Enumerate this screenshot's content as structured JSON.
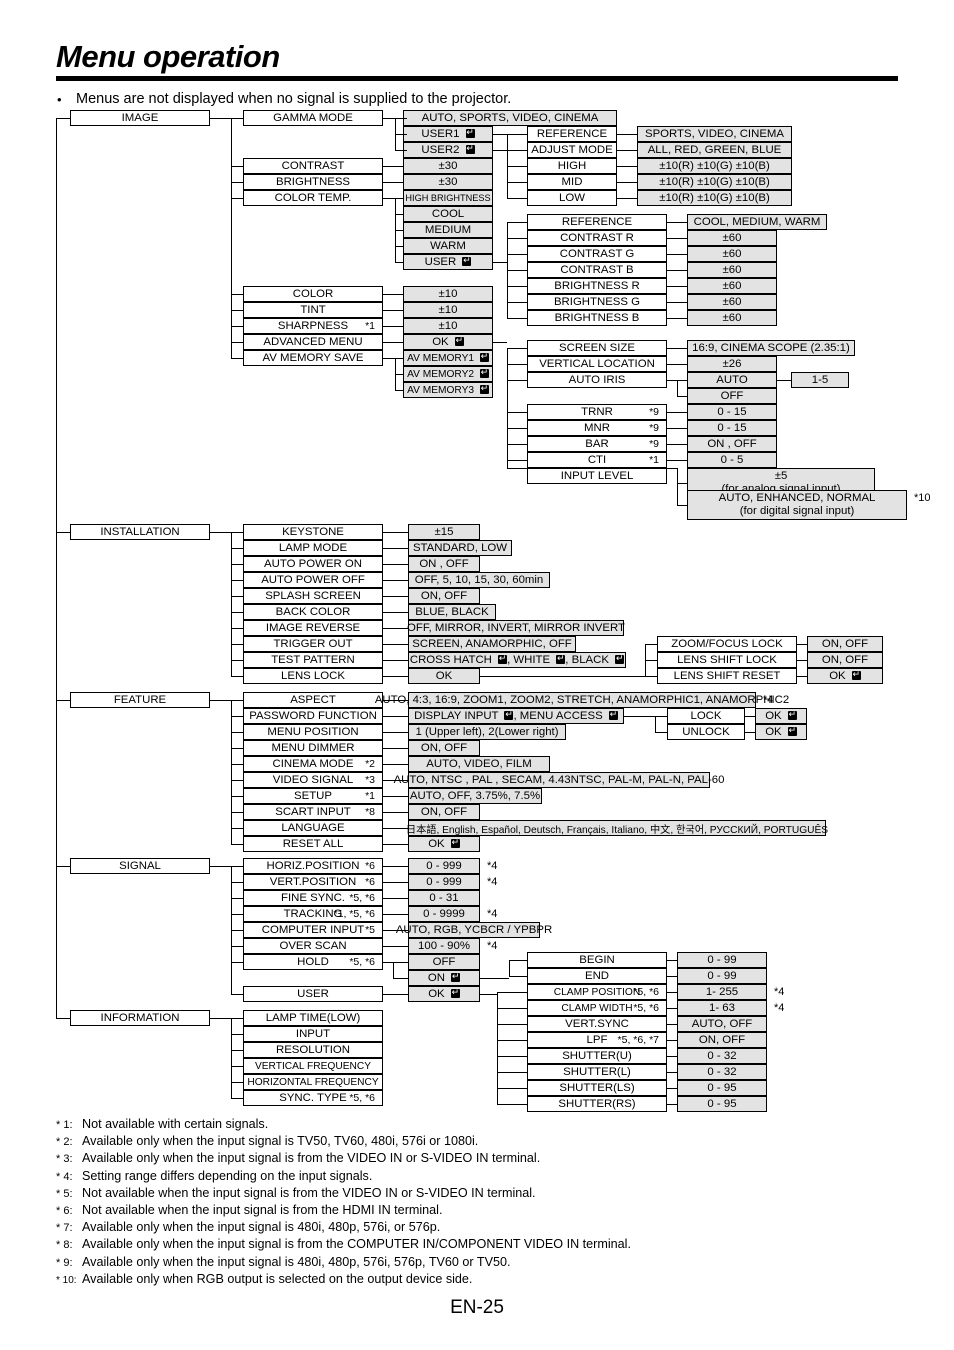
{
  "header": {
    "title": "Menu operation",
    "bullet": "Menus are not displayed when no signal is supplied to the projector.",
    "bullet_marker": "•"
  },
  "page_number": "EN-25",
  "menus": {
    "image": "IMAGE",
    "installation": "INSTALLATION",
    "feature": "FEATURE",
    "signal": "SIGNAL",
    "information": "INFORMATION"
  },
  "image_section": {
    "items": [
      {
        "label": "GAMMA MODE",
        "values": [
          "AUTO, SPORTS, VIDEO, CINEMA",
          "USER1",
          "USER2"
        ]
      },
      {
        "label": "CONTRAST",
        "values": [
          "±30"
        ]
      },
      {
        "label": "BRIGHTNESS",
        "values": [
          "±30"
        ]
      },
      {
        "label": "COLOR TEMP.",
        "values": [
          "HIGH BRIGHTNESS",
          "COOL",
          "MEDIUM",
          "WARM",
          "USER"
        ]
      },
      {
        "label": "COLOR",
        "values": [
          "±10"
        ]
      },
      {
        "label": "TINT",
        "values": [
          "±10"
        ]
      },
      {
        "label": "SHARPNESS",
        "footnote": "*1",
        "values": [
          "±10"
        ]
      },
      {
        "label": "ADVANCED MENU",
        "values": [
          "OK"
        ]
      },
      {
        "label": "AV MEMORY SAVE",
        "values": [
          "AV MEMORY1",
          "AV MEMORY2",
          "AV MEMORY3"
        ]
      }
    ],
    "gamma_user": {
      "rows": [
        {
          "label": "REFERENCE",
          "value": "SPORTS, VIDEO, CINEMA"
        },
        {
          "label": "ADJUST MODE",
          "value": "ALL, RED, GREEN, BLUE"
        },
        {
          "label": "HIGH",
          "value": "±10(R) ±10(G) ±10(B)"
        },
        {
          "label": "MID",
          "value": "±10(R) ±10(G) ±10(B)"
        },
        {
          "label": "LOW",
          "value": "±10(R) ±10(G) ±10(B)"
        }
      ]
    },
    "color_temp_user": {
      "rows": [
        {
          "label": "REFERENCE",
          "value": "COOL, MEDIUM, WARM"
        },
        {
          "label": "CONTRAST R",
          "value": "±60"
        },
        {
          "label": "CONTRAST G",
          "value": "±60"
        },
        {
          "label": "CONTRAST B",
          "value": "±60"
        },
        {
          "label": "BRIGHTNESS R",
          "value": "±60"
        },
        {
          "label": "BRIGHTNESS G",
          "value": "±60"
        },
        {
          "label": "BRIGHTNESS B",
          "value": "±60"
        }
      ]
    },
    "advanced_menu": {
      "rows": [
        {
          "label": "SCREEN SIZE",
          "value": "16:9, CINEMA SCOPE (2.35:1)"
        },
        {
          "label": "VERTICAL LOCATION",
          "value": "±26"
        },
        {
          "label": "AUTO IRIS",
          "value": "AUTO",
          "value2": "OFF",
          "sub": "1-5"
        },
        {
          "label": "TRNR",
          "footnote": "*9",
          "value": "0 - 15"
        },
        {
          "label": "MNR",
          "footnote": "*9",
          "value": "0 - 15"
        },
        {
          "label": "BAR",
          "footnote": "*9",
          "value": "ON , OFF"
        },
        {
          "label": "CTI",
          "footnote": "*1",
          "value": "0 - 5"
        },
        {
          "label": "INPUT LEVEL",
          "value": "",
          "value2": ""
        }
      ],
      "input_level_analog_l1": "±5",
      "input_level_analog_l2": "(for analog signal input)",
      "input_level_digital_l1": "AUTO, ENHANCED, NORMAL",
      "input_level_digital_l2": "(for digital signal input)",
      "input_level_digital_note": "*10"
    }
  },
  "installation_section": {
    "items": [
      {
        "label": "KEYSTONE",
        "value": "±15"
      },
      {
        "label": "LAMP MODE",
        "value": "STANDARD, LOW"
      },
      {
        "label": "AUTO POWER ON",
        "value": "ON , OFF"
      },
      {
        "label": "AUTO POWER OFF",
        "value": "OFF, 5, 10, 15, 30, 60min"
      },
      {
        "label": "SPLASH SCREEN",
        "value": "ON, OFF"
      },
      {
        "label": "BACK COLOR",
        "value": "BLUE, BLACK"
      },
      {
        "label": "IMAGE REVERSE",
        "value": "OFF, MIRROR, INVERT, MIRROR INVERT"
      },
      {
        "label": "TRIGGER OUT",
        "value": "SCREEN, ANAMORPHIC, OFF"
      },
      {
        "label": "TEST PATTERN",
        "value": "CROSS HATCH ↵, WHITE ↵, BLACK ↵"
      },
      {
        "label": "LENS LOCK",
        "value": "OK"
      }
    ],
    "lens_lock": {
      "rows": [
        {
          "label": "ZOOM/FOCUS LOCK",
          "value": "ON, OFF"
        },
        {
          "label": "LENS SHIFT LOCK",
          "value": "ON, OFF"
        },
        {
          "label": "LENS SHIFT RESET",
          "value": "OK"
        }
      ]
    }
  },
  "feature_section": {
    "items": [
      {
        "label": "ASPECT",
        "value": "AUTO, 4:3, 16:9, ZOOM1, ZOOM2, STRETCH, ANAMORPHIC1, ANAMORPHIC2",
        "note": "*4"
      },
      {
        "label": "PASSWORD FUNCTION",
        "value": "DISPLAY INPUT ↵, MENU ACCESS ↵"
      },
      {
        "label": "MENU POSITION",
        "value": "1 (Upper left), 2(Lower right)"
      },
      {
        "label": "MENU DIMMER",
        "value": "ON, OFF"
      },
      {
        "label": "CINEMA MODE",
        "footnote": "*2",
        "value": "AUTO, VIDEO, FILM"
      },
      {
        "label": "VIDEO SIGNAL",
        "footnote": "*3",
        "value": "AUTO, NTSC , PAL , SECAM, 4.43NTSC, PAL-M, PAL-N, PAL-60"
      },
      {
        "label": "SETUP",
        "footnote": "*1",
        "value": "AUTO, OFF, 3.75%, 7.5%"
      },
      {
        "label": "SCART INPUT",
        "footnote": "*8",
        "value": "ON, OFF"
      },
      {
        "label": "LANGUAGE",
        "value": "日本語, English, Español, Deutsch, Français, Italiano, 中文, 한국어, РУССКИЙ, PORTUGUÊS"
      },
      {
        "label": "RESET ALL",
        "value": "OK"
      }
    ],
    "password": {
      "rows": [
        {
          "label": "LOCK",
          "value": "OK"
        },
        {
          "label": "UNLOCK",
          "value": "OK"
        }
      ]
    }
  },
  "signal_section": {
    "items": [
      {
        "label": "HORIZ.POSITION",
        "footnote": "*6",
        "value": "0 - 999",
        "note": "*4"
      },
      {
        "label": "VERT.POSITION",
        "footnote": "*6",
        "value": "0 - 999",
        "note": "*4"
      },
      {
        "label": "FINE SYNC.",
        "footnote": "*5, *6",
        "value": "0 - 31"
      },
      {
        "label": "TRACKING",
        "footnote": "*1, *5, *6",
        "value": "0 - 9999",
        "note": "*4"
      },
      {
        "label": "COMPUTER INPUT",
        "footnote": "*5",
        "value": "AUTO, RGB, YCBCR / YPBPR"
      },
      {
        "label": "OVER SCAN",
        "value": "100 - 90%",
        "note": "*4"
      },
      {
        "label": "HOLD",
        "footnote": "*5, *6",
        "value": "OFF",
        "value2": "ON"
      },
      {
        "label": "USER",
        "value": "OK"
      }
    ],
    "hold_sub": {
      "rows": [
        {
          "label": "BEGIN",
          "value": "0 - 99"
        },
        {
          "label": "END",
          "value": "0 - 99"
        }
      ]
    },
    "user_sub": {
      "rows": [
        {
          "label": "CLAMP POSITION",
          "footnote": "*5, *6",
          "value": "1- 255",
          "note": "*4"
        },
        {
          "label": "CLAMP WIDTH",
          "footnote": "*5, *6",
          "value": "1- 63",
          "note": "*4"
        },
        {
          "label": "VERT.SYNC",
          "value": "AUTO, OFF"
        },
        {
          "label": "LPF",
          "footnote": "*5, *6, *7",
          "value": "ON, OFF"
        },
        {
          "label": "SHUTTER(U)",
          "value": "0 - 32"
        },
        {
          "label": "SHUTTER(L)",
          "value": "0 - 32"
        },
        {
          "label": "SHUTTER(LS)",
          "value": "0 - 95"
        },
        {
          "label": "SHUTTER(RS)",
          "value": "0 - 95"
        }
      ]
    }
  },
  "information_section": {
    "items": [
      {
        "label": "LAMP TIME(LOW)"
      },
      {
        "label": "INPUT"
      },
      {
        "label": "RESOLUTION"
      },
      {
        "label": "VERTICAL FREQUENCY"
      },
      {
        "label": "HORIZONTAL FREQUENCY"
      },
      {
        "label": "SYNC. TYPE",
        "footnote": "*5, *6"
      }
    ]
  },
  "footnotes": [
    {
      "mark": "* 1:",
      "text": "Not available with certain signals."
    },
    {
      "mark": "* 2:",
      "text": "Available only when the input signal is TV50, TV60, 480i, 576i or 1080i."
    },
    {
      "mark": "* 3:",
      "text": "Available only when the input signal is from the VIDEO IN or S-VIDEO IN terminal."
    },
    {
      "mark": "* 4:",
      "text": "Setting range differs depending on the input signals."
    },
    {
      "mark": "* 5:",
      "text": "Not available when the input signal is from the VIDEO IN or S-VIDEO IN terminal."
    },
    {
      "mark": "* 6:",
      "text": "Not available when the input signal is from the HDMI IN terminal."
    },
    {
      "mark": "* 7:",
      "text": "Available only when the input signal is 480i, 480p, 576i, or 576p."
    },
    {
      "mark": "* 8:",
      "text": "Available only when the input signal is from the COMPUTER IN/COMPONENT VIDEO IN terminal."
    },
    {
      "mark": "* 9:",
      "text": "Available only when the input signal is 480i, 480p, 576i, 576p, TV60 or TV50."
    },
    {
      "mark": "* 10:",
      "text": "Available only when RGB output is selected on the output device side."
    }
  ]
}
